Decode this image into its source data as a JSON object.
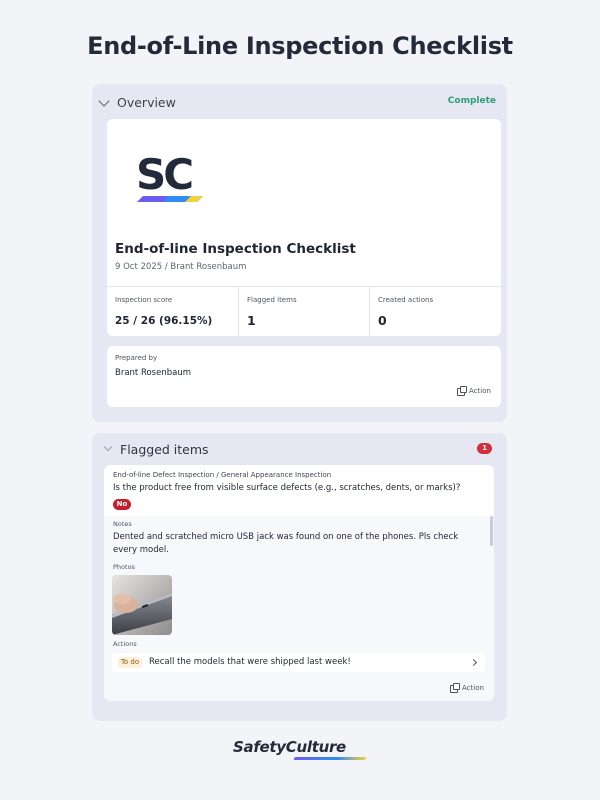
{
  "page": {
    "title": "End-of-Line Inspection Checklist"
  },
  "overview": {
    "section_title": "Overview",
    "status": "Complete",
    "logo_alt": "SC",
    "report_title": "End-of-line Inspection Checklist",
    "report_sub": "9 Oct 2025 / Brant Rosenbaum",
    "stats": [
      {
        "label": "Inspection score",
        "value": "25 / 26 (96.15%)"
      },
      {
        "label": "Flagged items",
        "value": "1"
      },
      {
        "label": "Created actions",
        "value": "0"
      }
    ],
    "prepared_by_label": "Prepared by",
    "prepared_by_name": "Brant Rosenbaum",
    "action_label": "Action"
  },
  "flagged": {
    "section_title": "Flagged items",
    "count": "1",
    "breadcrumb": "End-of-line Defect Inspection / General Appearance Inspection",
    "question": "Is the product free from visible surface defects (e.g., scratches, dents, or marks)?",
    "answer": "No",
    "notes_label": "Notes",
    "notes_text": "Dented and scratched micro USB jack was found on one of the phones. Pls check every model.",
    "photos_label": "Photos",
    "actions_label": "Actions",
    "todo_tag": "To do",
    "todo_text": "Recall the models that were shipped last week!",
    "action_label": "Action"
  },
  "footer": {
    "brand": "SafetyCulture"
  },
  "colors": {
    "complete": "#2f9c74",
    "badge_red": "#c31f2a",
    "panel_bg": "#e5e7f3"
  }
}
